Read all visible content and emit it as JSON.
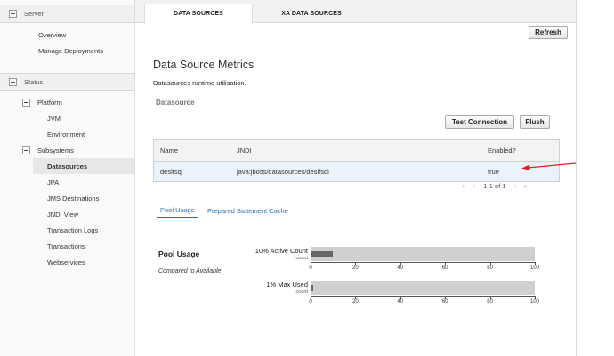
{
  "sidebar": {
    "server_section": "Server",
    "server_items": [
      "Overview",
      "Manage Deployments"
    ],
    "status_section": "Status",
    "platform_group": "Platform",
    "platform_items": [
      "JVM",
      "Environment"
    ],
    "subsystems_group": "Subsystems",
    "subsystem_items": [
      "Datasources",
      "JPA",
      "JMS Destinations",
      "JNDI View",
      "Transaction Logs",
      "Transactions",
      "Webservices"
    ],
    "selected": "Datasources"
  },
  "tabs": {
    "active": "DATA SOURCES",
    "inactive": "XA DATA SOURCES"
  },
  "toolbar": {
    "refresh_label": "Refresh"
  },
  "page": {
    "title": "Data Source Metrics",
    "description": "Datasources runtime utilisation.",
    "section_label": "Datasource",
    "test_connection_label": "Test Connection",
    "flush_label": "Flush"
  },
  "table": {
    "headers": [
      "Name",
      "JNDI",
      "Enabled?"
    ],
    "rows": [
      {
        "name": "desifsql",
        "jndi": "java:jboss/datasources/desifsql",
        "enabled": "true"
      }
    ],
    "pager_text": "1-1 of 1"
  },
  "subtabs": {
    "active": "Pool Usage",
    "inactive": "Prepared Statement Cache"
  },
  "pool": {
    "title": "Pool Usage",
    "subtitle": "Compared to Available",
    "count_label": "count"
  },
  "chart_data": {
    "type": "bar",
    "orientation": "horizontal",
    "categories": [
      "10% Active Count",
      "1% Max Used"
    ],
    "values": [
      10,
      1
    ],
    "xlim": [
      0,
      100
    ],
    "ticks": [
      0,
      20,
      40,
      60,
      80,
      100
    ]
  },
  "colors": {
    "annotation_arrow": "#e02020",
    "link": "#2a6fb0"
  }
}
